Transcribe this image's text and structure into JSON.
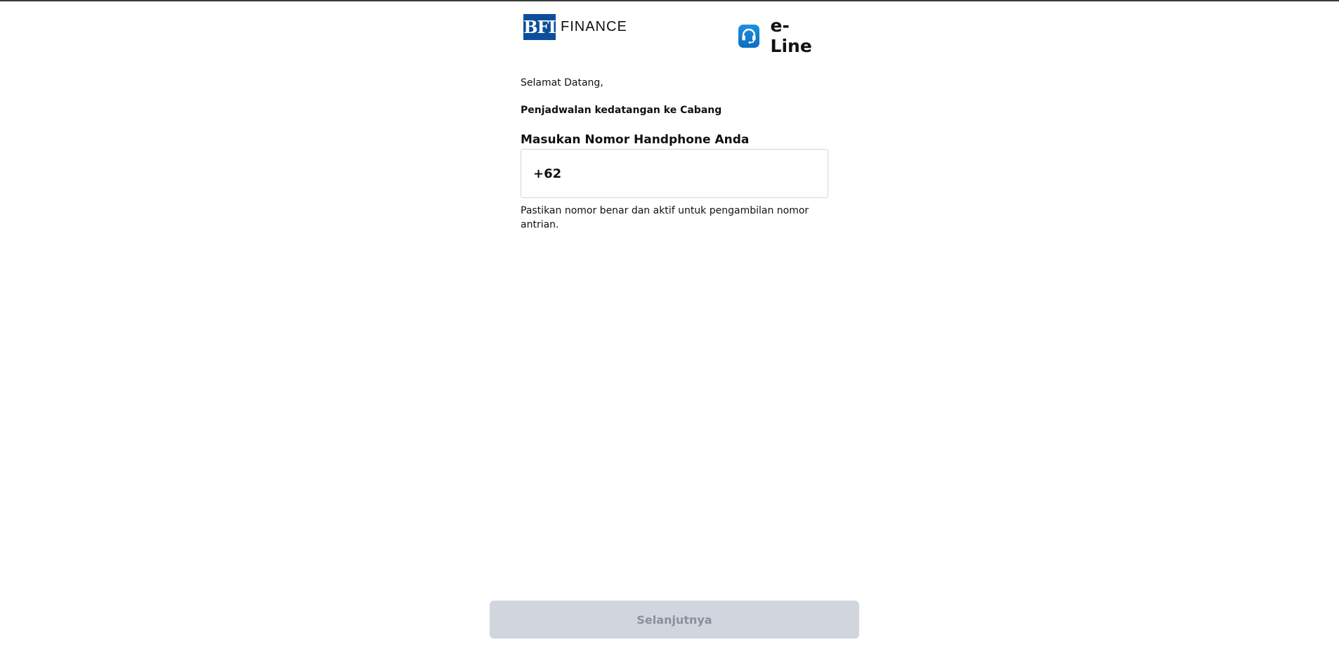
{
  "header": {
    "brand_box": "BFI",
    "brand_text": "FINANCE",
    "service_name": "e-Line",
    "service_icon": "headset-icon",
    "brand_color": "#0b4f9c",
    "service_color": "#0b6fc0"
  },
  "main": {
    "greeting": "Selamat Datang,",
    "subtitle": "Penjadwalan kedatangan ke Cabang",
    "phone_label": "Masukan Nomor Handphone Anda",
    "phone_value": "+62",
    "hint": "Pastikan nomor benar dan aktif untuk pengambilan nomor antrian."
  },
  "footer": {
    "next_label": "Selanjutnya",
    "next_disabled_color": "#d1d5de"
  }
}
